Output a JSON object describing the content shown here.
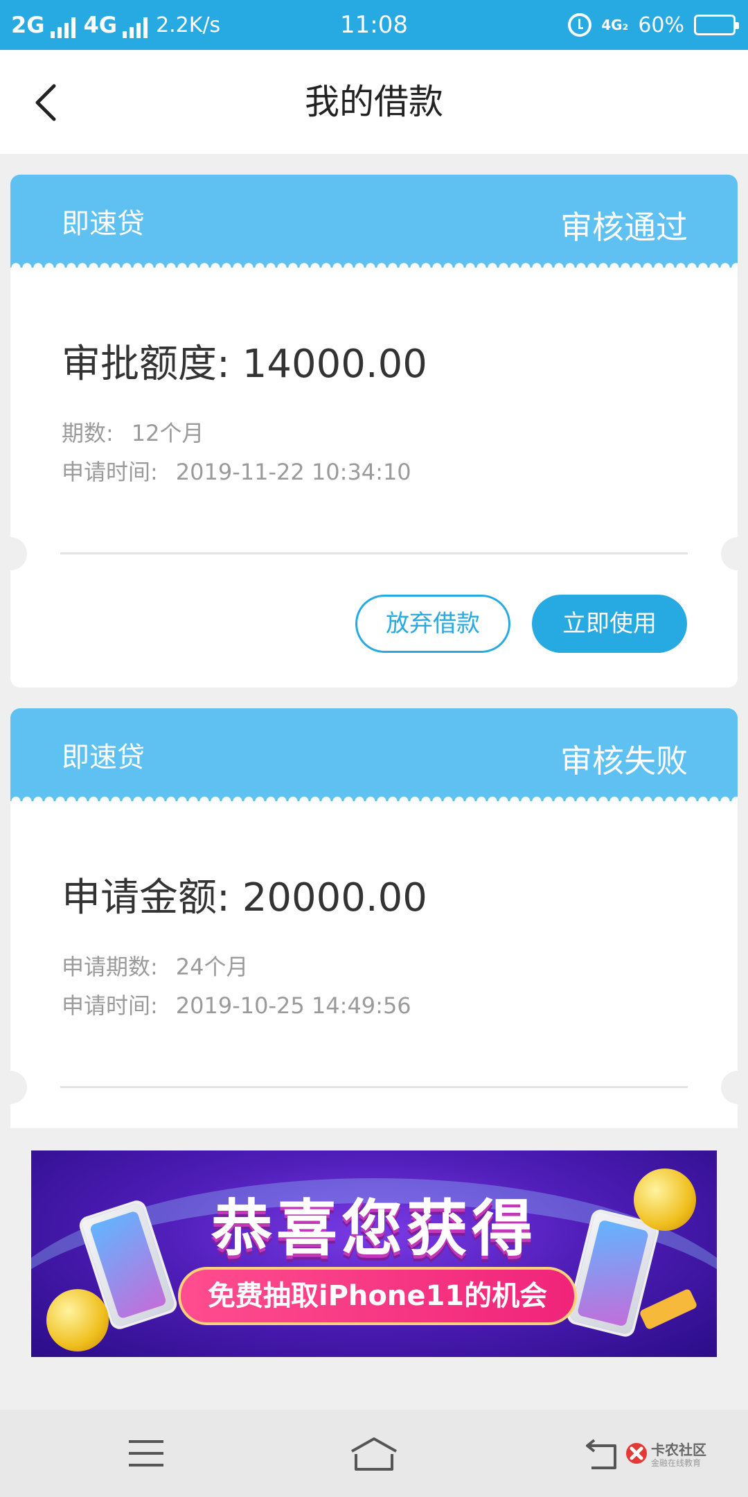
{
  "status_bar": {
    "network1": "2G",
    "network2": "4G",
    "speed": "2.2K/s",
    "time": "11:08",
    "sig_badge": "4G₂",
    "battery": "60%",
    "battery_level": 0.6
  },
  "header": {
    "title": "我的借款"
  },
  "loans": [
    {
      "product": "即速贷",
      "status": "审核通过",
      "amount_label": "审批额度:",
      "amount": "14000.00",
      "term_label": "期数:",
      "term": "12个月",
      "time_label": "申请时间:",
      "time": "2019-11-22 10:34:10",
      "buttons": {
        "abandon": "放弃借款",
        "use": "立即使用"
      }
    },
    {
      "product": "即速贷",
      "status": "审核失败",
      "amount_label": "申请金额:",
      "amount": "20000.00",
      "term_label": "申请期数:",
      "term": "24个月",
      "time_label": "申请时间:",
      "time": "2019-10-25 14:49:56"
    }
  ],
  "banner": {
    "title": "恭喜您获得",
    "subtitle": "免费抽取iPhone11的机会"
  },
  "watermark": {
    "name": "卡农社区",
    "sub": "金融在线教育"
  },
  "colors": {
    "accent": "#27a9e1",
    "card_header": "#5ec1f1"
  }
}
